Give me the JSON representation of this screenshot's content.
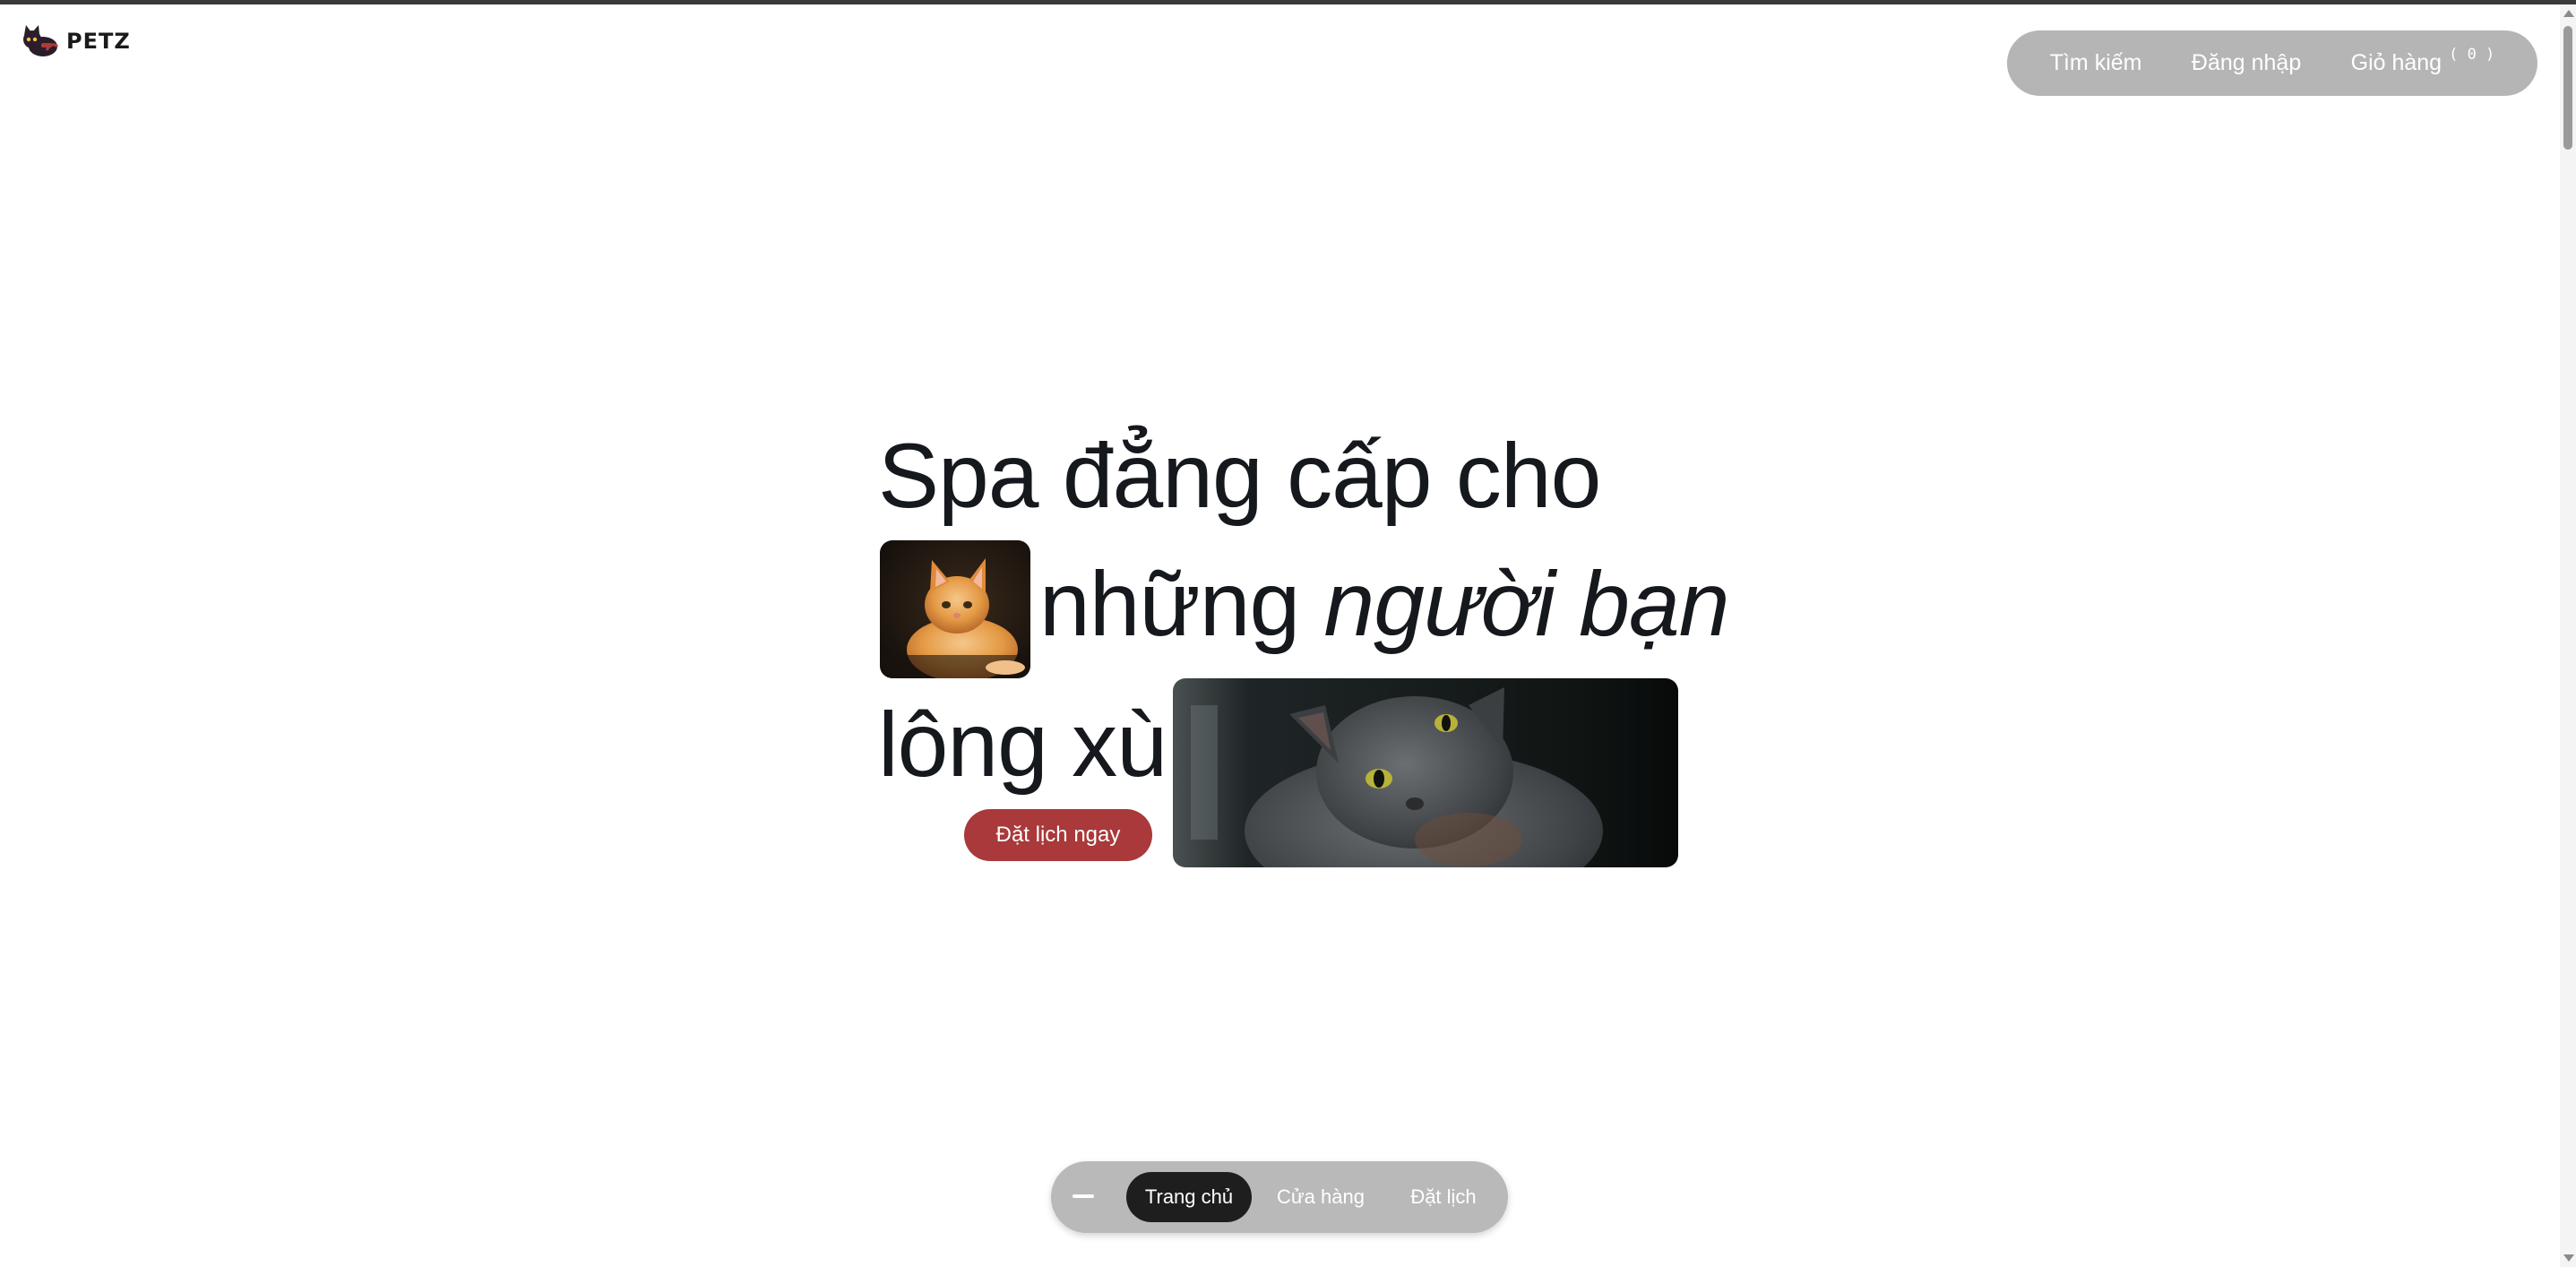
{
  "brand": {
    "name": "PETZ",
    "logo_icon": "cat-logo-icon"
  },
  "topnav": {
    "search_label": "Tìm kiếm",
    "login_label": "Đăng nhập",
    "cart_label": "Giỏ hàng",
    "cart_count": "( 0 )"
  },
  "hero": {
    "line1": "Spa đẳng cấp cho",
    "line2_plain": "những ",
    "line2_italic": "người bạn",
    "line3": "lông xù",
    "cta_label": "Đặt lịch ngay",
    "image1_desc": "orange-kitten-image",
    "image2_desc": "gray-cat-image"
  },
  "bottomnav": {
    "menu_icon": "minus-icon",
    "items": [
      {
        "label": "Trang chủ",
        "active": true
      },
      {
        "label": "Cửa hàng",
        "active": false
      },
      {
        "label": "Đặt lịch",
        "active": false
      }
    ]
  },
  "colors": {
    "accent": "#a9393a",
    "nav_bg": "#b5b5b5",
    "active_pill": "#1e1e1e",
    "text": "#15181d"
  }
}
